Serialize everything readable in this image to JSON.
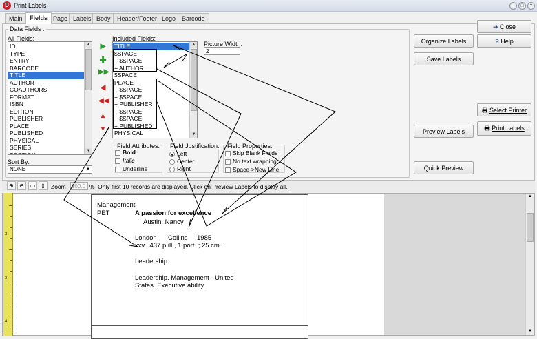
{
  "window": {
    "title": "Print Labels",
    "app_icon_letter": "D"
  },
  "tabs": [
    "Main",
    "Fields",
    "Page",
    "Labels",
    "Body",
    "Header/Footer",
    "Logo",
    "Barcode"
  ],
  "active_tab": "Fields",
  "data_fields": {
    "group_label": "Data Fields :",
    "all_fields_label": "All Fields:",
    "all_fields": [
      "ID",
      "TYPE",
      "ENTRY",
      "BARCODE",
      "TITLE",
      "AUTHOR",
      "COAUTHORS",
      "FORMAT",
      "ISBN",
      "EDITION",
      "PUBLISHER",
      "PLACE",
      "PUBLISHED",
      "PHYSICAL",
      "SERIES",
      "SECTION"
    ],
    "all_fields_selected": "TITLE",
    "sort_by_label": "Sort By:",
    "sort_by_value": "NONE",
    "included_fields_label": "Included Fields:",
    "included_fields": [
      "TITLE",
      "$SPACE",
      "+ $SPACE",
      "+ AUTHOR",
      "$SPACE",
      "PLACE",
      "+ $SPACE",
      "+ $SPACE",
      "+ PUBLISHER",
      "+ $SPACE",
      "+ $SPACE",
      "+ PUBLISHED",
      "PHYSICAL"
    ],
    "included_fields_selected": "TITLE",
    "picture_width_label": "Picture Width:",
    "picture_width_value": "2",
    "field_attributes": {
      "label": "Field Attributes:",
      "options": [
        "Bold",
        "Italic",
        "Underline"
      ]
    },
    "field_justification": {
      "label": "Field Justification:",
      "options": [
        "Left",
        "Center",
        "Right"
      ],
      "selected": "Left"
    },
    "field_properties": {
      "label": "Field Properties:",
      "options": [
        "Skip Blank Fields",
        "No text wrapping",
        "Space->New Line"
      ]
    }
  },
  "buttons": {
    "close": "Close",
    "help": "Help",
    "organize_labels": "Organize Labels",
    "save_labels": "Save Labels",
    "select_printer": "Select Printer",
    "preview_labels": "Preview Labels",
    "print_labels": "Print Labels",
    "quick_preview": "Quick Preview"
  },
  "preview_toolbar": {
    "zoom_label": "Zoom",
    "zoom_value": "100.0",
    "zoom_unit": "%",
    "status": "Only first 10 records are displayed. Click on Preview Labels to display all."
  },
  "ruler_numbers": [
    "2",
    "3",
    "4"
  ],
  "label_preview": {
    "line1": "Management",
    "line2_left": "PET",
    "title": "A passion for excellence",
    "author": "Austin, Nancy",
    "place": "London",
    "publisher": "Collins",
    "published": "1985",
    "physical": "xxv., 437 p  ill., 1 port. ; 25 cm.",
    "series": "Leadership",
    "subjects_1": "Leadership. Management - United",
    "subjects_2": "States. Executive ability."
  },
  "colors": {
    "selection": "#3377d6",
    "ruler": "#e8e25d"
  }
}
